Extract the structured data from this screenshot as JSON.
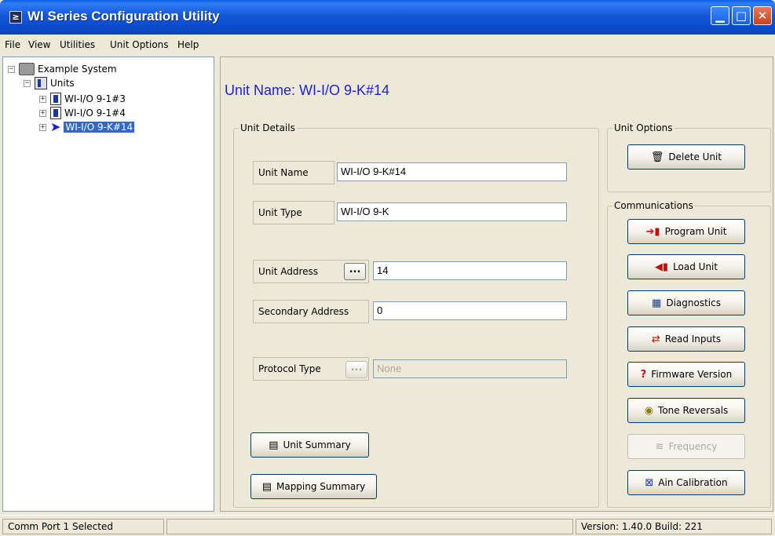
{
  "window": {
    "title": "WI Series Configuration Utility"
  },
  "menu": [
    "File",
    "View",
    "Utilities",
    "Unit Options",
    "Help"
  ],
  "tree": {
    "root": "Example System",
    "group": "Units",
    "items": [
      "WI-I/O 9-1#3",
      "WI-I/O 9-1#4",
      "WI-I/O 9-K#14"
    ]
  },
  "unit_heading": "Unit Name: WI-I/O 9-K#14",
  "unit_details": {
    "legend": "Unit Details",
    "unit_name_label": "Unit Name",
    "unit_name_value": "WI-I/O 9-K#14",
    "unit_type_label": "Unit Type",
    "unit_type_value": "WI-I/O 9-K",
    "unit_address_label": "Unit Address",
    "unit_address_value": "14",
    "secondary_address_label": "Secondary Address",
    "secondary_address_value": "0",
    "protocol_type_label": "Protocol Type",
    "protocol_type_value": "None",
    "ellipsis": "...",
    "unit_summary": "Unit Summary",
    "mapping_summary": "Mapping Summary"
  },
  "unit_options": {
    "legend": "Unit Options",
    "delete_unit": "Delete Unit"
  },
  "communications": {
    "legend": "Communications",
    "program_unit": "Program Unit",
    "load_unit": "Load Unit",
    "diagnostics": "Diagnostics",
    "read_inputs": "Read Inputs",
    "firmware_version": "Firmware Version",
    "tone_reversals": "Tone Reversals",
    "frequency": "Frequency",
    "ain_calibration": "Ain Calibration"
  },
  "status": {
    "left": "Comm Port 1 Selected",
    "right": "Version: 1.40.0 Build: 221"
  },
  "colors": {
    "heading": "#1e1edb",
    "selection": "#316ac5",
    "titlebar": "#0a4ccc"
  }
}
